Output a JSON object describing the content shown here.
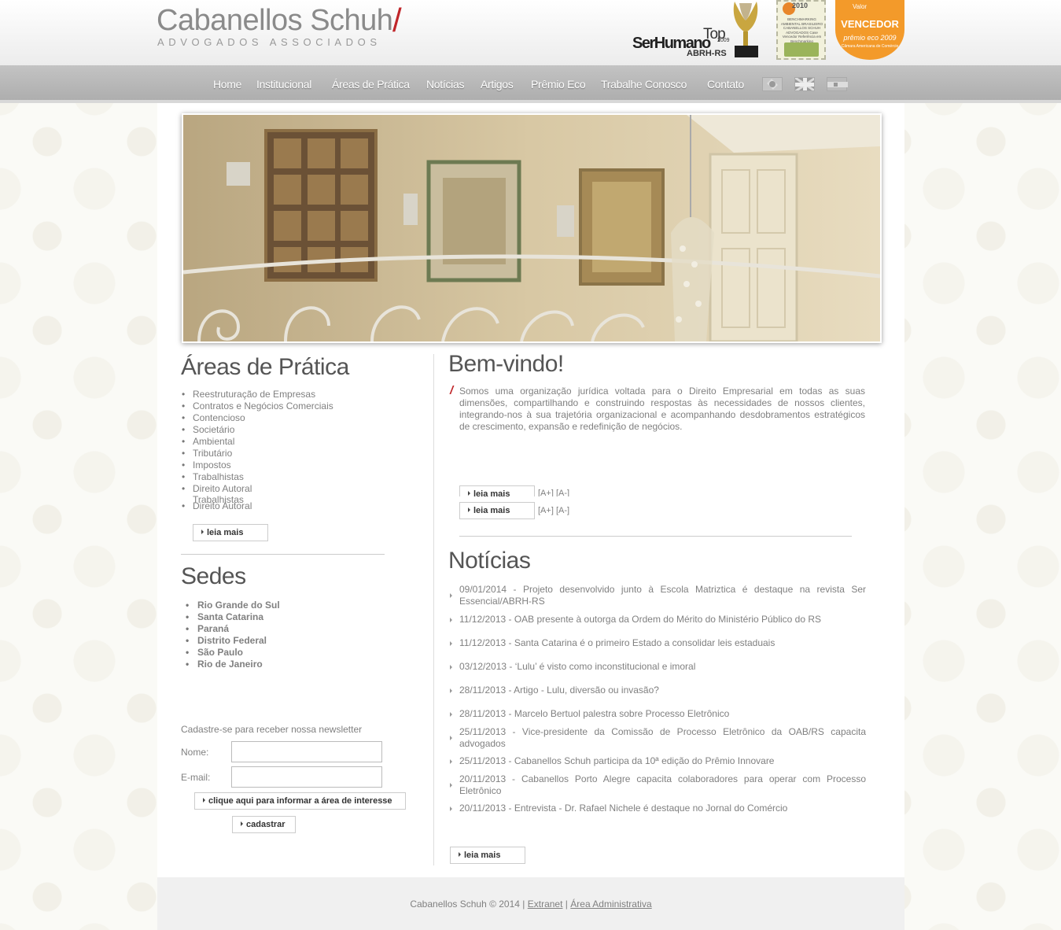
{
  "brand": {
    "name": "Cabanellos Schuh",
    "slash": "/",
    "subtitle": "ADVOGADOS ASSOCIADOS"
  },
  "awards": {
    "ser_humano": {
      "brand": "SerHumano",
      "top": "Top",
      "org": "ABRH-RS",
      "year": "2009"
    },
    "stamp": {
      "year": "2010",
      "text": "BENCHMARKING AMBIENTAL BRASILEIRO CABANELLOS SCHUH ADVOGADOS Case Vencedor Referência em Benchmarking Socioambiental"
    },
    "vencedor": {
      "top": "Valor",
      "label": "VENCEDOR",
      "premio": "prêmio eco 2009",
      "sub": "Câmara Americana de Comércio"
    }
  },
  "nav": {
    "items": [
      "Home",
      "Institucional",
      "Áreas de Prática",
      "Notícias",
      "Artigos",
      "Prêmio Eco",
      "Trabalhe Conosco",
      "Contato"
    ],
    "flags": [
      "brazil-flag",
      "uk-flag",
      "spain-flag"
    ]
  },
  "areas": {
    "title": "Áreas de Prática",
    "items": [
      "Reestruturação de Empresas",
      "Contratos e Negócios Comerciais",
      "Contencioso",
      "Societário",
      "Ambiental",
      "Tributário",
      "Impostos",
      "Trabalhistas",
      "Direito Autoral"
    ],
    "dup_overlap": "Trabalhistas",
    "dup_last": "Direito Autoral",
    "read_more": "leia mais"
  },
  "sedes": {
    "title": "Sedes",
    "items": [
      "Rio Grande do Sul",
      "Santa Catarina",
      "Paraná",
      "Distrito Federal",
      "São Paulo",
      "Rio de Janeiro"
    ]
  },
  "newsletter": {
    "title": "Cadastre-se para receber nossa newsletter",
    "name_label": "Nome:",
    "email_label": "E-mail:",
    "name_value": "",
    "email_value": "",
    "interest_button": "clique aqui para informar a área de interesse",
    "submit_button": "cadastrar"
  },
  "welcome": {
    "title": "Bem-vindo!",
    "text": "Somos uma organização jurídica voltada para o Direito Empresarial em todas as suas dimensões, compartilhando e construindo respostas às necessidades de nossos clientes, integrando-nos à sua trajetória organizacional e acompanhando desdobramentos estratégicos de crescimento, expansão e redefinição de negócios.",
    "read_more": "leia mais",
    "font_plus": "[A+]",
    "font_minus": "[A-]"
  },
  "news": {
    "title": "Notícias",
    "items": [
      "09/01/2014 - Projeto desenvolvido junto à Escola Matriztica é destaque na revista Ser Essencial/ABRH-RS",
      "11/12/2013 - OAB presente à outorga da Ordem do Mérito do Ministério Público do RS",
      "11/12/2013 - Santa Catarina é o primeiro Estado a consolidar leis estaduais",
      "03/12/2013 - ‘Lulu’ é visto como inconstitucional e imoral",
      "28/11/2013 - Artigo - Lulu, diversão ou invasão?",
      "28/11/2013 - Marcelo Bertuol palestra sobre Processo Eletrônico",
      "25/11/2013 - Vice-presidente da Comissão de Processo Eletrônico da OAB/RS capacita advogados",
      "25/11/2013 - Cabanellos Schuh participa da 10ª edição do Prêmio Innovare",
      "20/11/2013 - Cabanellos Porto Alegre capacita colaboradores para operar com Processo Eletrônico",
      "20/11/2013 - Entrevista - Dr. Rafael Nichele é destaque no Jornal do Comércio"
    ],
    "read_more": "leia mais"
  },
  "footer": {
    "copyright": "Cabanellos Schuh © 2014 |",
    "sep": "|",
    "extranet": "Extranet",
    "admin": "Área Administrativa"
  }
}
